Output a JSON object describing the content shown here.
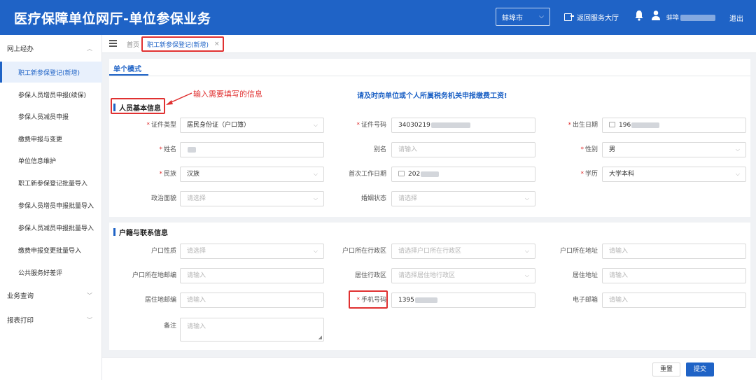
{
  "header": {
    "title": "医疗保障单位网厅-单位参保业务",
    "city": "蚌埠市",
    "return_label": "返回服务大厅",
    "user_name": "蚌埠",
    "logout_label": "退出",
    "bg_color": "#1f63c6"
  },
  "sidebar": {
    "groups": [
      {
        "label": "网上经办"
      },
      {
        "label": "业务查询"
      },
      {
        "label": "报表打印"
      }
    ],
    "items": [
      {
        "label": "职工新参保登记(新增)",
        "active": true
      },
      {
        "label": "参保人员增员申报(续保)"
      },
      {
        "label": "参保人员减员申报"
      },
      {
        "label": "缴费申报与变更"
      },
      {
        "label": "单位信息维护"
      },
      {
        "label": "职工新参保登记批量导入"
      },
      {
        "label": "参保人员增员申报批量导入"
      },
      {
        "label": "参保人员减员申报批量导入"
      },
      {
        "label": "缴费申报变更批量导入"
      },
      {
        "label": "公共服务好差评"
      }
    ]
  },
  "tabs": {
    "home": "首页",
    "active": "职工新参保登记(新增)",
    "close": "×"
  },
  "mode_tab": "单个模式",
  "annotation": "输入需要填写的信息",
  "notice": "请及时向单位或个人所属税务机关申报缴费工资!",
  "sections": {
    "basic": "人员基本信息",
    "household": "户籍与联系信息"
  },
  "basic_fields": {
    "id_type": {
      "label": "证件类型",
      "value": "居民身份证（户口簿）"
    },
    "id_number": {
      "label": "证件号码",
      "value": "34030219"
    },
    "birth": {
      "label": "出生日期",
      "value": "196"
    },
    "name": {
      "label": "姓名",
      "value": ""
    },
    "alias": {
      "label": "别名",
      "placeholder": "请输入"
    },
    "gender": {
      "label": "性别",
      "value": "男"
    },
    "ethnicity": {
      "label": "民族",
      "value": "汉族"
    },
    "work_date": {
      "label": "首次工作日期",
      "value": "202"
    },
    "education": {
      "label": "学历",
      "value": "大学本科"
    },
    "political": {
      "label": "政治面貌",
      "placeholder": "请选择"
    },
    "marital": {
      "label": "婚姻状态",
      "placeholder": "请选择"
    }
  },
  "household_fields": {
    "hukou_type": {
      "label": "户口性质",
      "placeholder": "请选择"
    },
    "hukou_region": {
      "label": "户口所在行政区",
      "placeholder": "请选择户口所在行政区"
    },
    "hukou_address": {
      "label": "户口所在地址",
      "placeholder": "请输入"
    },
    "hukou_postal": {
      "label": "户口所在地邮编",
      "placeholder": "请输入"
    },
    "res_region": {
      "label": "居住行政区",
      "placeholder": "请选择居住地行政区"
    },
    "res_address": {
      "label": "居住地址",
      "placeholder": "请输入"
    },
    "res_postal": {
      "label": "居住地邮编",
      "placeholder": "请输入"
    },
    "mobile": {
      "label": "手机号码",
      "value": "1395"
    },
    "email": {
      "label": "电子邮箱",
      "placeholder": "请输入"
    },
    "remark": {
      "label": "备注",
      "placeholder": "请输入"
    }
  },
  "footer": {
    "reset": "重置",
    "submit": "提交"
  }
}
